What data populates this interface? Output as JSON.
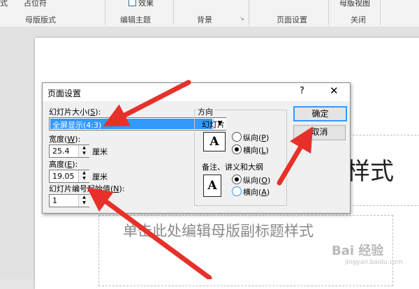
{
  "ribbon": {
    "top_items": [
      "式",
      "占位符",
      "效果",
      "母版视图"
    ],
    "groups": [
      "母版版式",
      "编辑主题",
      "背景",
      "页面设置",
      "关闭"
    ]
  },
  "slide": {
    "title_placeholder": "样式",
    "subtitle_placeholder": "单击此处编辑母版副标题样式",
    "watermark": "Bai 经验",
    "watermark_sub": "jingyan.baidu.com"
  },
  "dialog": {
    "title": "页面设置",
    "help": "?",
    "close": "✕",
    "size_label": "幻灯片大小(",
    "size_key": "S",
    "size_suffix": "):",
    "size_value": "全屏显示(4:3)",
    "width_label": "宽度(",
    "width_key": "W",
    "width_suffix": "):",
    "width_value": "25.4",
    "height_label": "高度(",
    "height_key": "E",
    "height_suffix": "):",
    "height_value": "19.05",
    "unit": "厘米",
    "start_label": "幻灯片编号起始值(",
    "start_key": "N",
    "start_suffix": "):",
    "start_value": "1",
    "orientation_title": "方向",
    "slides_label": "幻灯片",
    "notes_label": "备注、讲义和大纲",
    "slide_portrait": "纵向(",
    "slide_portrait_key": "P",
    "slide_landscape": "横向(",
    "slide_landscape_key": "L",
    "notes_portrait": "纵向(",
    "notes_portrait_key": "O",
    "notes_landscape": "横向(",
    "notes_landscape_key": "A",
    "paren_close": ")",
    "ok": "确定",
    "cancel": "取消",
    "icon_letter": "A"
  },
  "colors": {
    "selection": "#3399ff",
    "arrow": "#e8302a",
    "default_button_border": "#3399ff"
  }
}
